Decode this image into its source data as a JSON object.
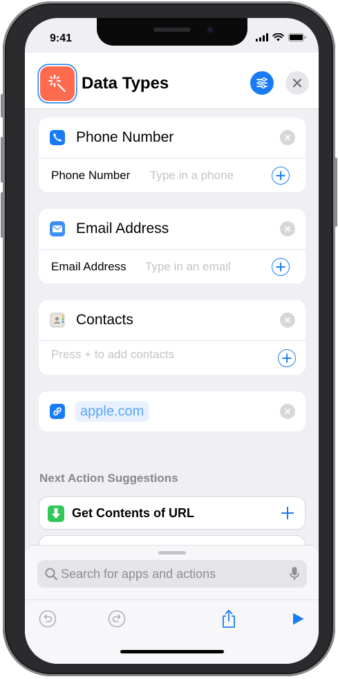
{
  "status_bar": {
    "time": "9:41"
  },
  "header": {
    "title": "Data Types"
  },
  "cards": {
    "phone": {
      "title": "Phone Number",
      "field_label": "Phone Number",
      "placeholder": "Type in a phone",
      "icon": "phone-icon",
      "icon_color": "#1a7cf5"
    },
    "email": {
      "title": "Email Address",
      "field_label": "Email Address",
      "placeholder": "Type in an email",
      "icon": "mail-icon",
      "icon_color": "#3a8ef6"
    },
    "contacts": {
      "title": "Contacts",
      "placeholder": "Press + to add contacts",
      "icon": "contacts-icon"
    },
    "url": {
      "value": "apple.com",
      "icon": "link-icon",
      "icon_color": "#1a7cf5"
    }
  },
  "suggestions": {
    "header": "Next Action Suggestions",
    "items": [
      {
        "label": "Get Contents of URL",
        "icon": "download-icon",
        "icon_color": "#31c759"
      }
    ]
  },
  "bottom_sheet": {
    "search_placeholder": "Search for apps and actions"
  },
  "colors": {
    "accent": "#1a7cf5",
    "app_icon": "#ff6b4f",
    "background": "#efeff4"
  }
}
